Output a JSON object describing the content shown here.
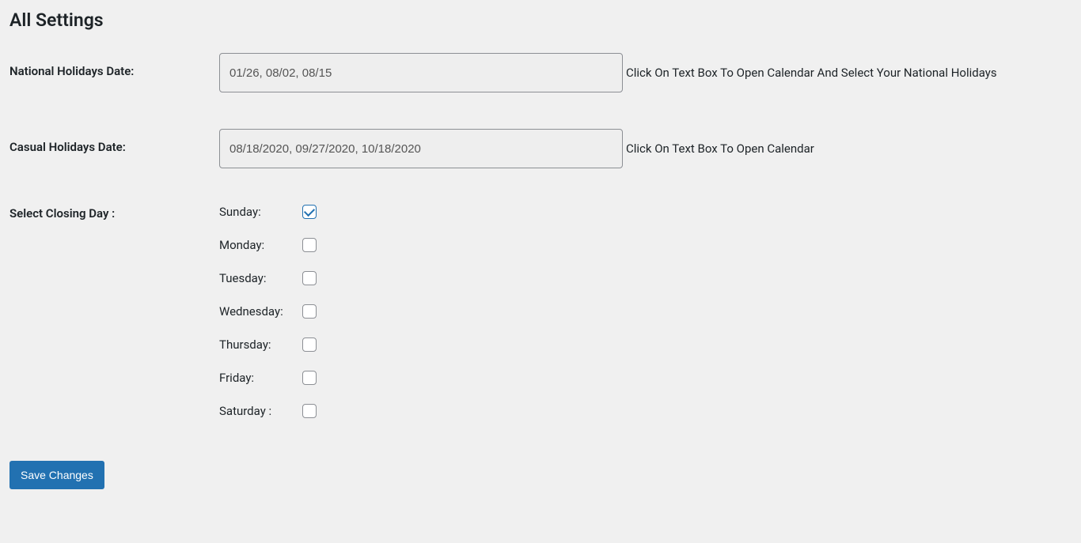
{
  "page_title": "All Settings",
  "national_holidays": {
    "label": "National Holidays Date:",
    "value": "01/26, 08/02, 08/15",
    "help": "Click On Text Box To Open Calendar And Select Your National Holidays"
  },
  "casual_holidays": {
    "label": "Casual Holidays Date:",
    "value": "08/18/2020, 09/27/2020, 10/18/2020",
    "help": "Click On Text Box To Open Calendar"
  },
  "closing_day": {
    "label": "Select Closing Day :",
    "days": [
      {
        "label": "Sunday:",
        "checked": true
      },
      {
        "label": "Monday:",
        "checked": false
      },
      {
        "label": "Tuesday:",
        "checked": false
      },
      {
        "label": "Wednesday:",
        "checked": false
      },
      {
        "label": "Thursday:",
        "checked": false
      },
      {
        "label": "Friday:",
        "checked": false
      },
      {
        "label": "Saturday :",
        "checked": false
      }
    ]
  },
  "save_button": "Save Changes"
}
